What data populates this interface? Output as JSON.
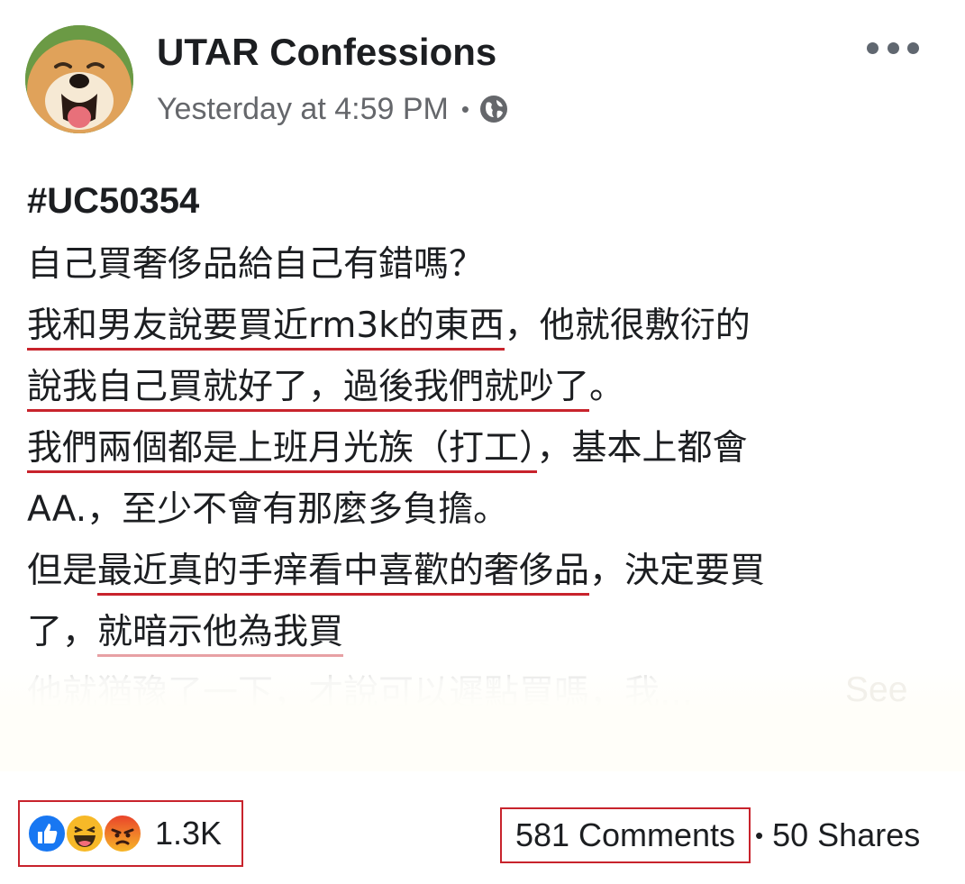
{
  "header": {
    "page_name": "UTAR Confessions",
    "timestamp": "Yesterday at 4:59 PM",
    "separator": "•",
    "privacy_icon": "globe-icon",
    "more_icon": "more-options-icon"
  },
  "post": {
    "hashtag": "#UC50354",
    "lines": [
      [
        {
          "t": "自己買奢侈品給自己有錯嗎？",
          "u": false
        }
      ],
      [
        {
          "t": "我和男友說要買近rm3k的東西",
          "u": true
        },
        {
          "t": "，他就很敷衍的",
          "u": false
        }
      ],
      [
        {
          "t": "說我自己買就好了，過後我們就吵了",
          "u": true
        },
        {
          "t": "。",
          "u": false
        }
      ],
      [
        {
          "t": "我們兩個都是上班月光族（打工）",
          "u": true
        },
        {
          "t": "，基本上都會",
          "u": false
        }
      ],
      [
        {
          "t": "AA.，至少不會有那麼多負擔。",
          "u": false
        }
      ],
      [
        {
          "t": "但是",
          "u": false
        },
        {
          "t": "最近真的手痒看中喜歡的奢侈品",
          "u": true
        },
        {
          "t": "，決定要買",
          "u": false
        }
      ],
      [
        {
          "t": "了，",
          "u": false
        },
        {
          "t": "就暗示他為我買",
          "u": true
        }
      ],
      [
        {
          "t": "他就猶豫了一下，才說可以遲點買嗎，我... ",
          "u": false
        }
      ]
    ],
    "see_more": "See"
  },
  "footer": {
    "reaction_icons": [
      "like-icon",
      "haha-icon",
      "angry-icon"
    ],
    "reaction_count": "1.3K",
    "comments": "581 Comments",
    "separator": "•",
    "shares": "50 Shares"
  },
  "colors": {
    "underline": "#c8232c",
    "meta_text": "#65676b",
    "like_blue": "#1877f2",
    "haha_yellow": "#f7b928",
    "angry_orange": "#f0582a"
  }
}
